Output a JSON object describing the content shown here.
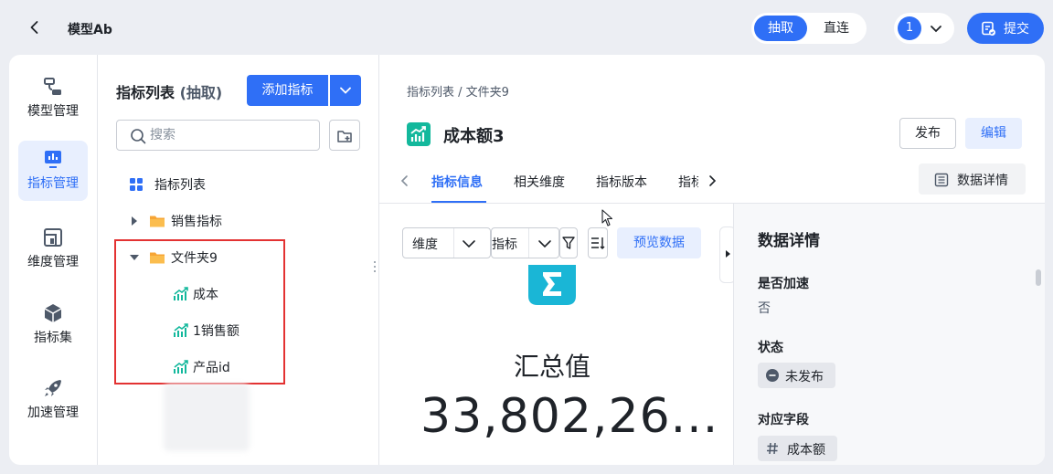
{
  "header": {
    "title": "模型Ab",
    "mode_active": "抽取",
    "mode_other": "直连",
    "user_badge": "1",
    "submit_label": "提交"
  },
  "nav": {
    "items": [
      {
        "label": "模型管理",
        "icon": "model-icon",
        "active": false
      },
      {
        "label": "指标管理",
        "icon": "metric-chart-icon",
        "active": true
      },
      {
        "label": "维度管理",
        "icon": "dimension-icon",
        "active": false
      },
      {
        "label": "指标集",
        "icon": "cube-icon",
        "active": false
      },
      {
        "label": "加速管理",
        "icon": "rocket-icon",
        "active": false
      }
    ]
  },
  "list": {
    "title": "指标列表",
    "title_sub": "(抽取)",
    "add_label": "添加指标",
    "search_placeholder": "搜索",
    "tree": [
      {
        "label": "指标列表",
        "icon": "grid-icon",
        "level": 0
      },
      {
        "label": "销售指标",
        "icon": "folder-icon",
        "level": 0,
        "expanded": false
      },
      {
        "label": "文件夹9",
        "icon": "folder-icon",
        "level": 0,
        "expanded": true
      },
      {
        "label": "成本",
        "icon": "metric-trend-icon",
        "level": 1
      },
      {
        "label": "1销售额",
        "icon": "metric-trend-icon",
        "level": 1
      },
      {
        "label": "产品id",
        "icon": "metric-trend-icon",
        "level": 1
      }
    ]
  },
  "detail": {
    "breadcrumb": "指标列表 / 文件夹9",
    "title": "成本额3",
    "publish_label": "发布",
    "edit_label": "编辑",
    "tabs": [
      "指标信息",
      "相关维度",
      "指标版本",
      "指标"
    ],
    "active_tab": "指标信息",
    "data_detail_btn": "数据详情",
    "dimension_select": "维度",
    "metric_select": "指标",
    "preview_label": "预览数据",
    "summary_label": "汇总值",
    "summary_value": "33,802,26..."
  },
  "details_panel": {
    "title": "数据详情",
    "accel_label": "是否加速",
    "accel_value": "否",
    "status_label": "状态",
    "status_value": "未发布",
    "field_label": "对应字段",
    "field_value": "成本额"
  },
  "colors": {
    "accent": "#2f6ff6",
    "highlight_box": "#e33232",
    "metric_icon": "#13b89c"
  }
}
